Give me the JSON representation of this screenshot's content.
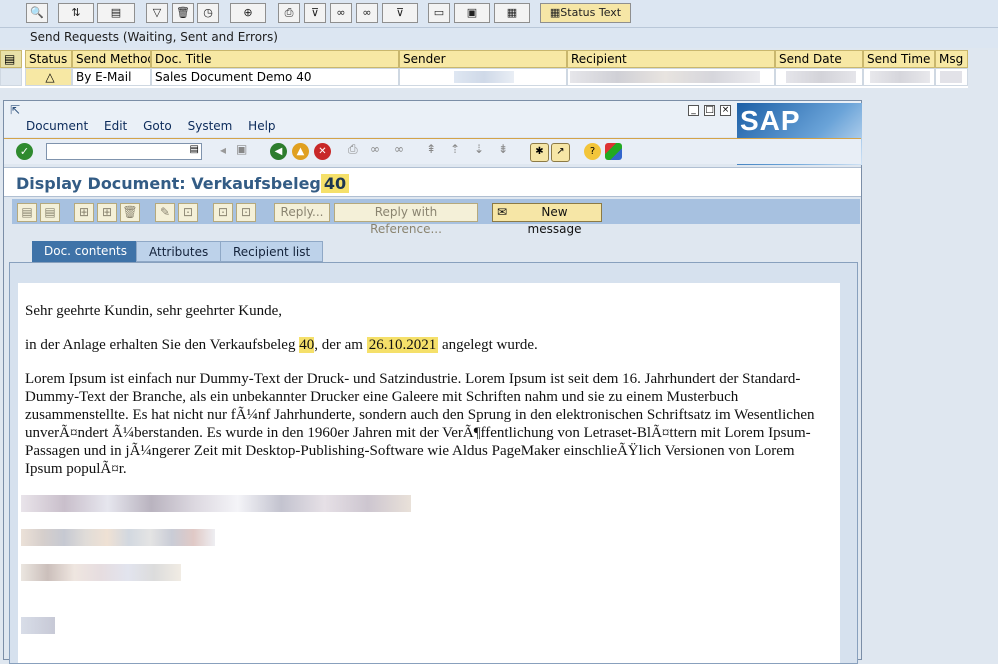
{
  "outer": {
    "toolbar": {
      "status_text_button": "Status Text"
    },
    "title": "Send Requests (Waiting, Sent and Errors)",
    "grid": {
      "headers": [
        "Status",
        "Send Method",
        "Doc. Title",
        "Sender",
        "Recipient",
        "Send Date",
        "Send Time",
        "Msg"
      ],
      "row": {
        "status_icon": "warning-icon",
        "send_method": "By E-Mail",
        "doc_title": "Sales Document Demo 40"
      }
    }
  },
  "sap": {
    "menu": [
      "Document",
      "Edit",
      "Goto",
      "System",
      "Help"
    ],
    "logo": "SAP",
    "title": {
      "prefix": "Display Document: Verkaufsbeleg",
      "number": "40"
    },
    "app_toolbar": {
      "reply": "Reply...",
      "reply_ref": "Reply with Reference...",
      "new_message": "New message"
    },
    "tabs": [
      "Doc. contents",
      "Attributes",
      "Recipient list"
    ],
    "content": {
      "greeting": "Sehr geehrte Kundin, sehr geehrter Kunde,",
      "line2_a": "in der Anlage erhalten Sie den Verkaufsbeleg ",
      "line2_num": "40",
      "line2_b": ", der am ",
      "line2_date": "26.10.2021",
      "line2_c": " angelegt wurde.",
      "lorem": "Lorem Ipsum ist einfach nur Dummy-Text der Druck- und Satzindustrie. Lorem Ipsum ist seit dem 16. Jahrhundert der Standard-Dummy-Text der Branche, als ein unbekannter Drucker eine Galeere mit Schriften nahm und sie zu einem Musterbuch zusammenstellte. Es hat nicht nur fÃ¼nf Jahrhunderte, sondern auch den Sprung in den elektronischen Schriftsatz im Wesentlichen unverÃ¤ndert Ã¼berstanden. Es wurde in den 1960er Jahren mit der VerÃ¶ffentlichung von Letraset-BlÃ¤ttern mit Lorem Ipsum-Passagen und in jÃ¼ngerer Zeit mit Desktop-Publishing-Software wie Aldus PageMaker einschlieÃŸlich Versionen von Lorem Ipsum populÃ¤r."
    }
  },
  "colors": {
    "highlight": "#f5e06a",
    "title_blue": "#335c85",
    "tab_active": "#3f73a8"
  }
}
